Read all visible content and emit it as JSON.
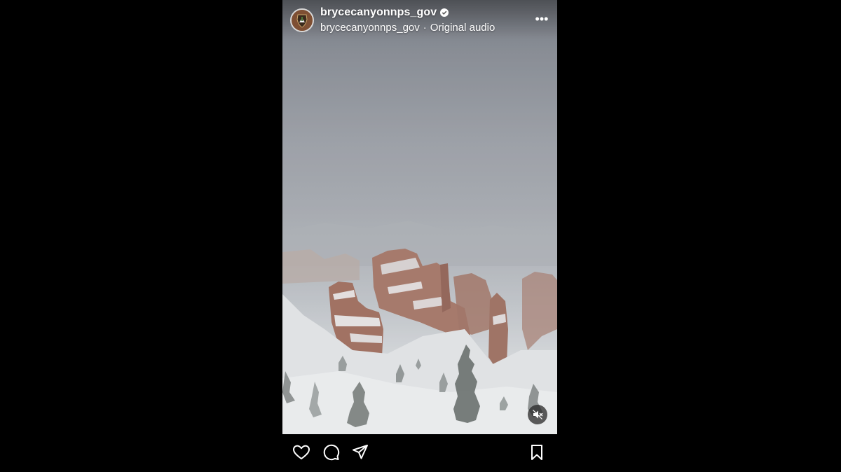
{
  "post": {
    "username": "brycecanyonnps_gov",
    "verified": true,
    "audio_owner": "brycecanyonnps_gov",
    "audio_separator": "·",
    "audio_label": "Original audio",
    "more_label": "•••"
  },
  "icons": {
    "avatar": "nps-arrowhead-icon",
    "verified": "verified-badge-icon",
    "more": "more-options-icon",
    "mute": "muted-speaker-icon",
    "like": "heart-icon",
    "comment": "comment-bubble-icon",
    "share": "paper-plane-icon",
    "save": "bookmark-icon"
  },
  "colors": {
    "page_background": "#000000",
    "text": "#ffffff",
    "fog": "#a3a6ad",
    "snow": "#e6e7ea",
    "hoodoo": "#9a6a58"
  }
}
